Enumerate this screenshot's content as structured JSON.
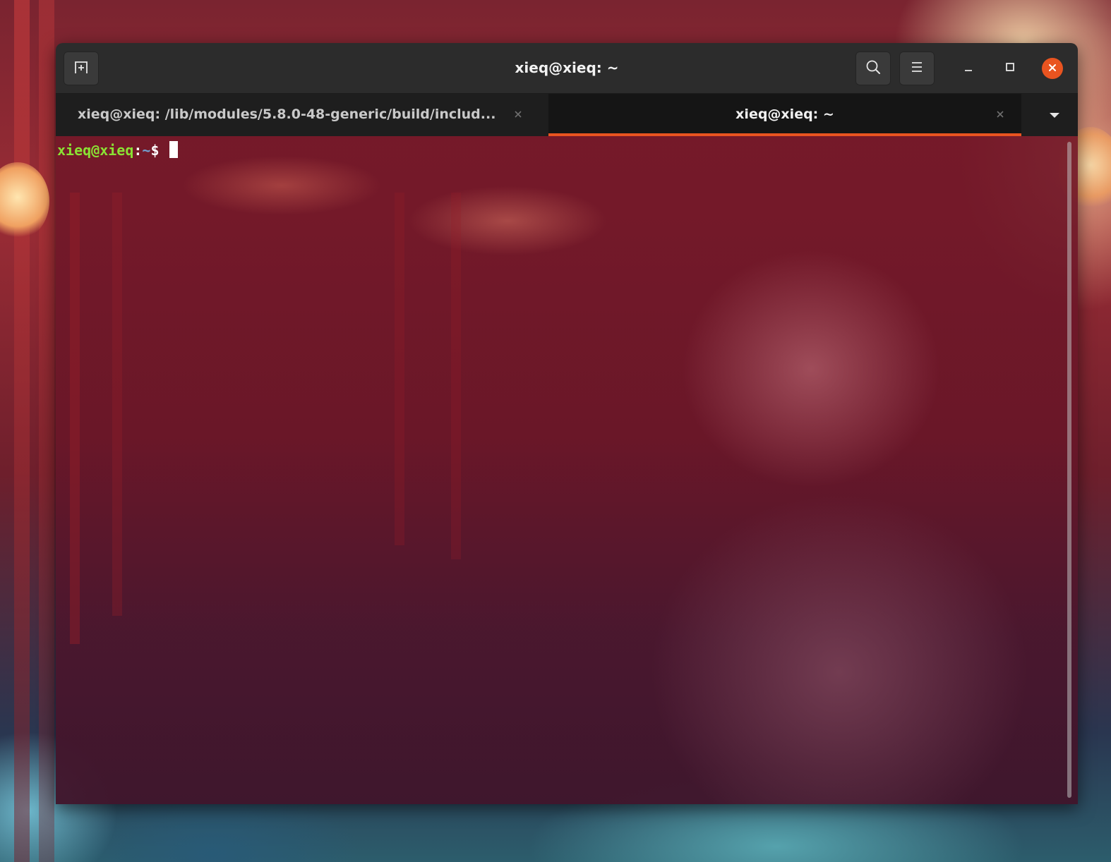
{
  "window": {
    "title": "xieq@xieq: ~"
  },
  "headerbar": {
    "new_tab_icon": "new-tab-icon",
    "search_icon": "search-icon",
    "menu_icon": "hamburger-menu-icon",
    "minimize_icon": "minimize-icon",
    "maximize_icon": "maximize-icon",
    "close_icon": "close-icon"
  },
  "tabs": [
    {
      "label": "xieq@xieq: /lib/modules/5.8.0-48-generic/build/includ...",
      "active": false
    },
    {
      "label": "xieq@xieq: ~",
      "active": true
    }
  ],
  "terminal": {
    "prompt_user": "xieq@xieq",
    "prompt_sep": ":",
    "prompt_path": "~",
    "prompt_symbol": "$ "
  },
  "colors": {
    "accent": "#e95420",
    "headerbar": "#2c2c2c",
    "prompt_user": "#8ae234",
    "prompt_path": "#729fcf"
  }
}
